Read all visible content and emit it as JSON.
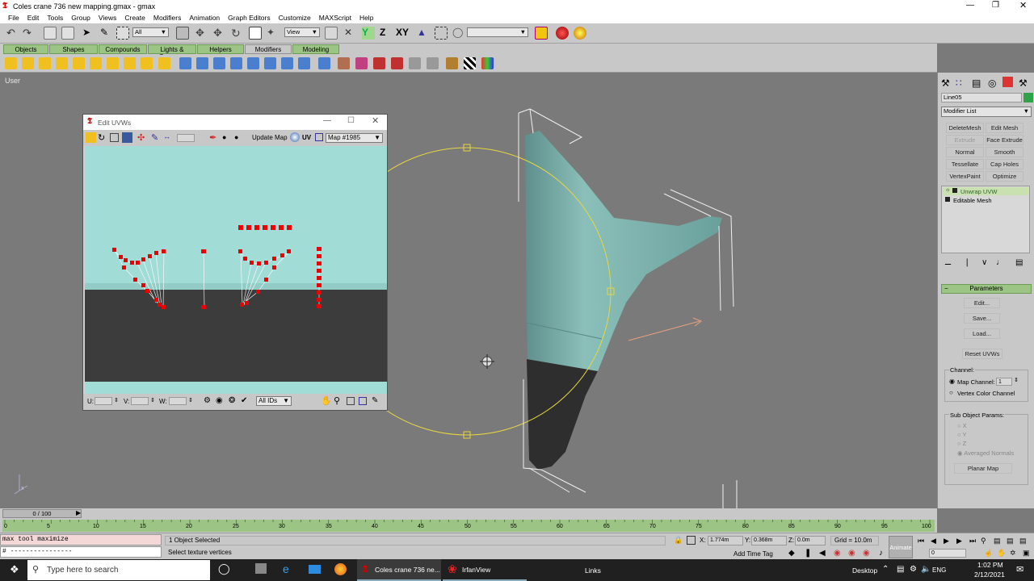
{
  "window": {
    "title": "Coles crane 736 new mapping.gmax - gmax"
  },
  "menu": [
    "File",
    "Edit",
    "Tools",
    "Group",
    "Views",
    "Create",
    "Modifiers",
    "Animation",
    "Graph Editors",
    "Customize",
    "MAXScript",
    "Help"
  ],
  "toolbar": {
    "selection_filter": "All",
    "ref_coord": "View"
  },
  "tabs": [
    "Objects",
    "Shapes",
    "Compounds",
    "Lights & Cameras",
    "Helpers",
    "Modifiers",
    "Modeling"
  ],
  "viewport": {
    "label": "User"
  },
  "uvw_editor": {
    "title": "Edit UVWs",
    "update_map": "Update Map",
    "uv_label": "UV",
    "map_select": "Map #1985",
    "u_label": "U:",
    "v_label": "V:",
    "w_label": "W:",
    "ids_select": "All IDs"
  },
  "command_panel": {
    "object_name": "Line05",
    "object_color": "#2fa24a",
    "modifier_list": "Modifier List",
    "modifier_buttons": [
      {
        "label": "DeleteMesh",
        "enabled": true
      },
      {
        "label": "Edit Mesh",
        "enabled": true
      },
      {
        "label": "Extrude",
        "enabled": false
      },
      {
        "label": "Face Extrude",
        "enabled": true
      },
      {
        "label": "Normal",
        "enabled": true
      },
      {
        "label": "Smooth",
        "enabled": true
      },
      {
        "label": "Tessellate",
        "enabled": true
      },
      {
        "label": "Cap Holes",
        "enabled": true
      },
      {
        "label": "VertexPaint",
        "enabled": true
      },
      {
        "label": "Optimize",
        "enabled": true
      }
    ],
    "stack": [
      "Unwrap UVW",
      "Editable Mesh"
    ],
    "parameters": {
      "header": "Parameters",
      "edit": "Edit...",
      "save": "Save...",
      "load": "Load...",
      "reset": "Reset UVWs",
      "channel_group": "Channel:",
      "map_channel": "Map Channel:",
      "map_channel_value": "1",
      "vertex_color_channel": "Vertex Color Channel",
      "sub_object_group": "Sub Object Params:",
      "axes": [
        "X",
        "Y",
        "Z"
      ],
      "averaged_normals": "Averaged Normals",
      "planar_map": "Planar Map"
    }
  },
  "timeline": {
    "frame_display": "0 / 100",
    "ticks": [
      "0",
      "5",
      "10",
      "15",
      "20",
      "25",
      "30",
      "35",
      "40",
      "45",
      "50",
      "55",
      "60",
      "65",
      "70",
      "75",
      "80",
      "85",
      "90",
      "95",
      "100"
    ]
  },
  "status": {
    "script_line1": "max tool maximize",
    "script_line2": "# ----------------",
    "selected": "1 Object Selected",
    "prompt": "Select texture vertices",
    "x_label": "X:",
    "x_value": "1.774m",
    "y_label": "Y:",
    "y_value": "0.368m",
    "z_label": "Z:",
    "z_value": "0.0m",
    "grid": "Grid = 10.0m",
    "add_time_tag": "Add Time Tag",
    "animate": "Animate",
    "frame_field": "0"
  },
  "taskbar": {
    "search_placeholder": "Type here to search",
    "app1": "Coles crane 736 ne...",
    "app2": "IrfanView",
    "links": "Links",
    "desktop": "Desktop",
    "lang": "ENG",
    "time": "1:02 PM",
    "date": "2/12/2021"
  }
}
